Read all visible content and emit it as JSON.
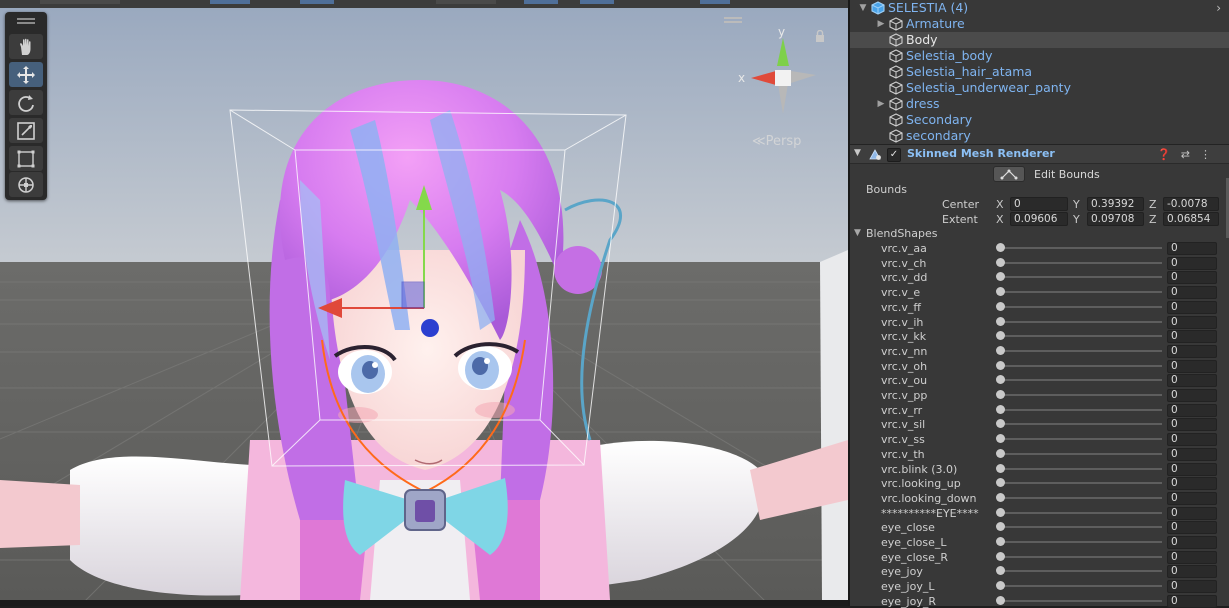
{
  "scene": {
    "gizmo": {
      "x_label": "x",
      "y_label": "y",
      "projection_label": "Persp"
    }
  },
  "hierarchy": {
    "items": [
      {
        "label": "SELESTIA (4)",
        "indent": 0,
        "expanded": true,
        "has_arrow": true,
        "style": "prefab",
        "selected": false
      },
      {
        "label": "Armature",
        "indent": 1,
        "expanded": false,
        "has_arrow": true,
        "style": "prefab",
        "selected": false
      },
      {
        "label": "Body",
        "indent": 1,
        "has_arrow": false,
        "style": "plain",
        "selected": true
      },
      {
        "label": "Selestia_body",
        "indent": 1,
        "has_arrow": false,
        "style": "prefab",
        "selected": false
      },
      {
        "label": "Selestia_hair_atama",
        "indent": 1,
        "has_arrow": false,
        "style": "prefab",
        "selected": false
      },
      {
        "label": "Selestia_underwear_panty",
        "indent": 1,
        "has_arrow": false,
        "style": "prefab",
        "selected": false
      },
      {
        "label": "dress",
        "indent": 1,
        "expanded": false,
        "has_arrow": true,
        "style": "prefab",
        "selected": false
      },
      {
        "label": "Secondary",
        "indent": 1,
        "has_arrow": false,
        "style": "prefab",
        "selected": false
      },
      {
        "label": "secondary",
        "indent": 1,
        "has_arrow": false,
        "style": "prefab",
        "selected": false
      }
    ]
  },
  "inspector": {
    "component_title": "Skinned Mesh Renderer",
    "component_enabled": true,
    "edit_bounds_label": "Edit Bounds",
    "bounds_label": "Bounds",
    "center_label": "Center",
    "extent_label": "Extent",
    "axis_x": "X",
    "axis_y": "Y",
    "axis_z": "Z",
    "center": {
      "x": "0",
      "y": "0.39392",
      "z": "-0.0078"
    },
    "extent": {
      "x": "0.09606",
      "y": "0.09708",
      "z": "0.06854"
    },
    "blendshapes_label": "BlendShapes",
    "blendshapes": [
      {
        "name": "vrc.v_aa",
        "value": "0"
      },
      {
        "name": "vrc.v_ch",
        "value": "0"
      },
      {
        "name": "vrc.v_dd",
        "value": "0"
      },
      {
        "name": "vrc.v_e",
        "value": "0"
      },
      {
        "name": "vrc.v_ff",
        "value": "0"
      },
      {
        "name": "vrc.v_ih",
        "value": "0"
      },
      {
        "name": "vrc.v_kk",
        "value": "0"
      },
      {
        "name": "vrc.v_nn",
        "value": "0"
      },
      {
        "name": "vrc.v_oh",
        "value": "0"
      },
      {
        "name": "vrc.v_ou",
        "value": "0"
      },
      {
        "name": "vrc.v_pp",
        "value": "0"
      },
      {
        "name": "vrc.v_rr",
        "value": "0"
      },
      {
        "name": "vrc.v_sil",
        "value": "0"
      },
      {
        "name": "vrc.v_ss",
        "value": "0"
      },
      {
        "name": "vrc.v_th",
        "value": "0"
      },
      {
        "name": "vrc.blink (3.0)",
        "value": "0"
      },
      {
        "name": "vrc.looking_up",
        "value": "0"
      },
      {
        "name": "vrc.looking_down",
        "value": "0"
      },
      {
        "name": "**********EYE****",
        "value": "0"
      },
      {
        "name": "eye_close",
        "value": "0"
      },
      {
        "name": "eye_close_L",
        "value": "0"
      },
      {
        "name": "eye_close_R",
        "value": "0"
      },
      {
        "name": "eye_joy",
        "value": "0"
      },
      {
        "name": "eye_joy_L",
        "value": "0"
      },
      {
        "name": "eye_joy_R",
        "value": "0"
      }
    ]
  },
  "icons": {
    "tools": [
      "hand-tool-icon",
      "move-tool-icon",
      "rotate-tool-icon",
      "scale-tool-icon",
      "rect-tool-icon",
      "transform-tool-icon"
    ],
    "active_tool": "move-tool-icon"
  },
  "colors": {
    "selection": "#4b4b4b",
    "prefab_text": "#7fb4f0",
    "component_title": "#8cc0f5",
    "gizmo_x": "#e04a3a",
    "gizmo_y": "#7ed04a",
    "gizmo_z": "#2b50d0"
  }
}
